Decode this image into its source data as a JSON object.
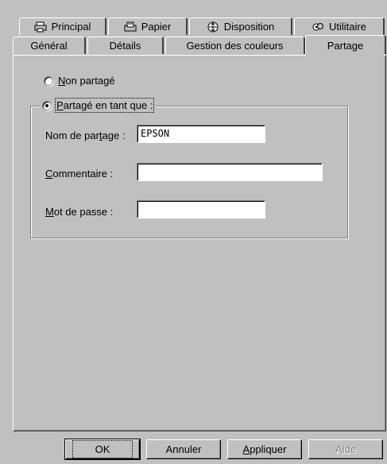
{
  "tabs_back": [
    {
      "label": "Principal",
      "icon": "printer-icon"
    },
    {
      "label": "Papier",
      "icon": "paper-icon"
    },
    {
      "label": "Disposition",
      "icon": "layout-icon"
    },
    {
      "label": "Utilitaire",
      "icon": "utility-icon"
    }
  ],
  "tabs_front": [
    {
      "label": "Général"
    },
    {
      "label": "Détails"
    },
    {
      "label": "Gestion des couleurs"
    },
    {
      "label": "Partage",
      "active": true
    }
  ],
  "sharing": {
    "not_shared": {
      "underline": "N",
      "rest": "on partagé",
      "checked": false
    },
    "shared_as": {
      "underline": "P",
      "rest": "artagé en tant que :",
      "checked": true
    },
    "share_name": {
      "label_a": "Nom de par",
      "label_u": "t",
      "label_b": "age :",
      "value": "EPSON"
    },
    "comment": {
      "label_u": "C",
      "label_b": "ommentaire :",
      "value": ""
    },
    "password": {
      "label_u": "M",
      "label_b": "ot de passe :",
      "value": ""
    }
  },
  "buttons": {
    "ok": "OK",
    "cancel": "Annuler",
    "apply_u": "A",
    "apply_rest": "ppliquer",
    "help": "Aide"
  },
  "colors": {
    "face": "#c0c0c0",
    "shadow": "#808080",
    "highlight": "#ffffff"
  }
}
